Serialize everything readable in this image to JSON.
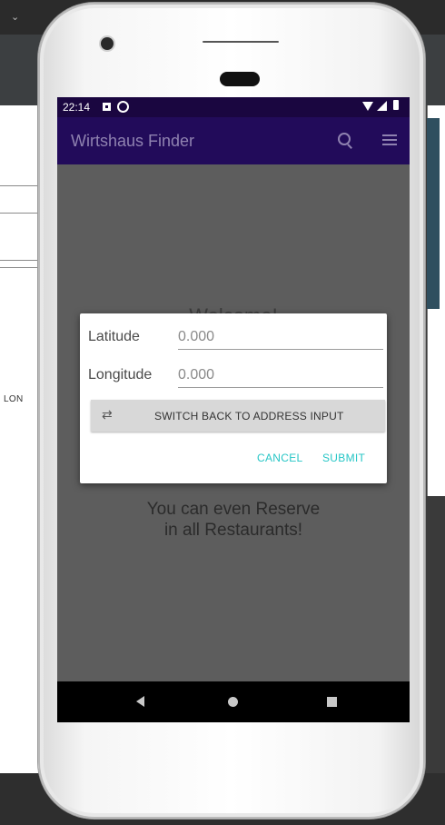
{
  "background": {
    "left_panel_text": "LON"
  },
  "status_bar": {
    "time": "22:14"
  },
  "app_bar": {
    "title": "Wirtshaus Finder",
    "search_icon": "search-icon",
    "menu_icon": "menu-icon"
  },
  "content": {
    "welcome_text": "Welcome!",
    "reserve_line1": "You can even Reserve",
    "reserve_line2": "in all Restaurants!"
  },
  "dialog": {
    "latitude_label": "Latitude",
    "latitude_value": "0.000",
    "longitude_label": "Longitude",
    "longitude_value": "0.000",
    "switch_icon": "swap-horizontal-icon",
    "switch_label": "SWITCH BACK TO ADDRESS INPUT",
    "cancel_label": "CANCEL",
    "submit_label": "SUBMIT"
  },
  "colors": {
    "status_bar": "#1a0640",
    "app_bar": "#220b5a",
    "accent": "#26c6c6",
    "scrim": "#5d5d5d"
  }
}
